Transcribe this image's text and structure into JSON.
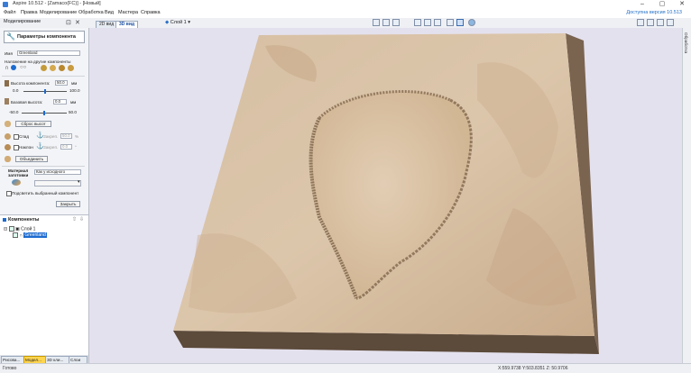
{
  "window": {
    "title": "Aspire 10.512 - [Zamaco(FC)] - [Новый]"
  },
  "menu": {
    "items": [
      "Файл",
      "Правка",
      "Моделирование",
      "Обработка",
      "Вид",
      "Мастера",
      "Справка"
    ],
    "update_notice": "Доступна версия 10.513"
  },
  "toolbar": {
    "mode_label": "Моделирование"
  },
  "view_tabs": [
    "2D вид",
    "3D вид"
  ],
  "layer_selector": {
    "value": "Слой 1"
  },
  "panel": {
    "header": "Параметры компонента",
    "name_label": "Имя",
    "name_value": "Greenland",
    "blend_label": "Наложение на другие компоненты",
    "height_label": "Высота компонента:",
    "height_value": "50.0",
    "height_unit": "мм",
    "height_min": "0.0",
    "height_max": "100.0",
    "base_label": "Базовая высота:",
    "base_value": "0.0",
    "base_unit": "мм",
    "base_min": "-50.0",
    "base_max": "50.0",
    "reset_button": "Сброс высот",
    "fade_label": "Спад",
    "tilt_label": "Наклон",
    "fix_label": "Закреп.",
    "fade_value": "50.0",
    "fade_unit": "%",
    "tilt_value": "0.0",
    "tilt_unit": "°",
    "merge_button": "Объединить",
    "material_label": "Материал заготовки",
    "material_value": "Как у исходного",
    "highlight_label": "Подсветить выбранный компонент",
    "close_button": "Закрыть"
  },
  "components": {
    "title": "Компоненты",
    "tree": [
      {
        "label": "Слой 1",
        "level": 1
      },
      {
        "label": "Greenland",
        "level": 2,
        "selected": true
      }
    ]
  },
  "bottom_tabs": [
    "Рисова...",
    "Модел...",
    "3D кли...",
    "Слои"
  ],
  "right_rail": {
    "label": "Обработка"
  },
  "status": {
    "left": "Готово",
    "coords": "X:559.9738 Y:503.8351 Z: 50.9706"
  },
  "colors": {
    "accent": "#1c6cc8",
    "viewport_bg": "#e4e1ee",
    "relief": "#d8c0a4",
    "base_slab": "#5c4a3a"
  }
}
